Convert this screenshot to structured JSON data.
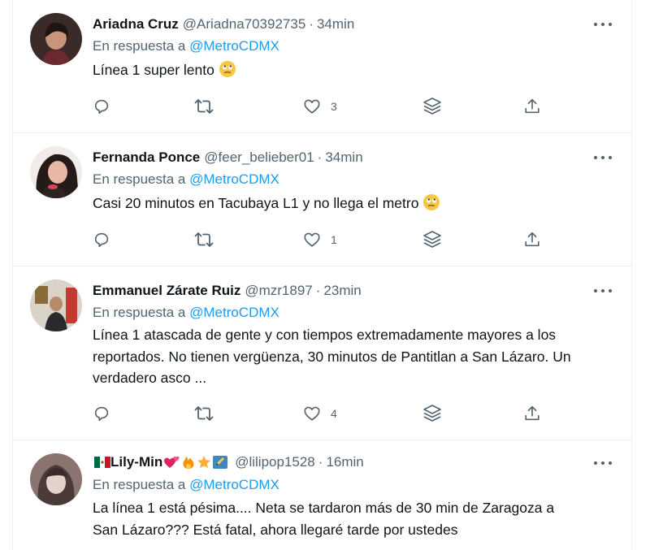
{
  "tweets": [
    {
      "name": "Ariadna Cruz",
      "handle": "@Ariadna70392735",
      "separator": "·",
      "time": "34min",
      "reply_prefix": "En respuesta a",
      "reply_to": "@MetroCDMX",
      "text": "Línea 1 super lento",
      "text_emoji": "face-with-rolling-eyes",
      "likes": "3",
      "avatar_colors": [
        "#3b2b28",
        "#c8957a"
      ]
    },
    {
      "name": "Fernanda Ponce",
      "handle": "@feer_belieber01",
      "separator": "·",
      "time": "34min",
      "reply_prefix": "En respuesta a",
      "reply_to": "@MetroCDMX",
      "text": "Casi 20 minutos en Tacubaya L1 y no llega el metro",
      "text_emoji": "face-with-rolling-eyes",
      "likes": "1",
      "avatar_colors": [
        "#241a18",
        "#e8b8a4"
      ]
    },
    {
      "name": "Emmanuel Zárate Ruiz",
      "handle": "@mzr1897",
      "separator": "·",
      "time": "23min",
      "reply_prefix": "En respuesta a",
      "reply_to": "@MetroCDMX",
      "text_lines": [
        "Línea 1 atascada de gente y con tiempos extremadamente mayores a los",
        "reportados. No tienen vergüenza, 30 minutos de Pantitlan a San Lázaro. Un",
        "verdadero asco ..."
      ],
      "likes": "4",
      "avatar_colors": [
        "#d9d4c7",
        "#2a2a2e"
      ]
    },
    {
      "name": "Lily-Min",
      "name_emojis": [
        "mexico-flag",
        "two-hearts",
        "fire",
        "star",
        "pencil"
      ],
      "handle": "@lilipop1528",
      "separator": "·",
      "time": "16min",
      "reply_prefix": "En respuesta a",
      "reply_to": "@MetroCDMX",
      "text_lines": [
        "La línea 1 está pésima.... Neta se tardaron más de 30 min de Zaragoza a",
        "San Lázaro??? Está fatal, ahora llegaré tarde por ustedes"
      ],
      "avatar_colors": [
        "#6a5a58",
        "#e3d2cc"
      ]
    }
  ],
  "icons": {
    "reply": "reply-icon",
    "retweet": "retweet-icon",
    "like": "like-icon",
    "stack": "stack-icon",
    "share": "share-icon",
    "more": "more-icon"
  },
  "colors": {
    "text": "#0f1419",
    "secondary": "#536471",
    "link": "#1d9bf0",
    "divider": "#eff3f4"
  }
}
